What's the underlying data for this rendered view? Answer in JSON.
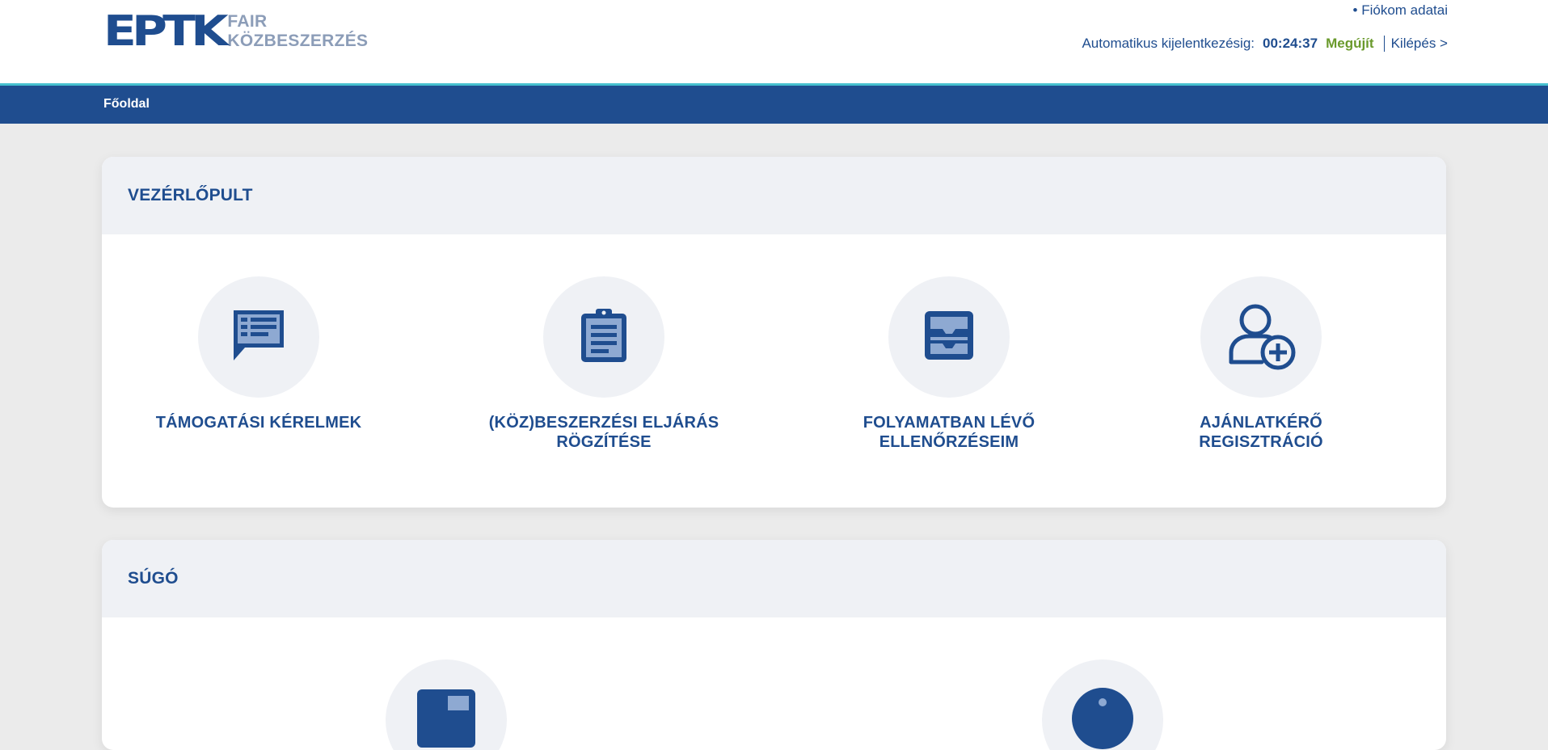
{
  "brand": {
    "logo_mark": "EPTK",
    "logo_line1": "FAIR",
    "logo_line2": "KÖZBESZERZÉS"
  },
  "header": {
    "account_link": "• Fiókom adatai",
    "session_label": "Automatikus kijelentkezésig:",
    "session_timer": "00:24:37",
    "renew_label": "Megújít",
    "logout_label": "Kilépés >"
  },
  "nav": {
    "home_label": "Főoldal"
  },
  "dashboard": {
    "title": "VEZÉRLŐPULT",
    "tiles": [
      {
        "label_line1": "TÁMOGATÁSI KÉRELMEK",
        "label_line2": "",
        "icon": "chat-list-icon"
      },
      {
        "label_line1": "(KÖZ)BESZERZÉSI ELJÁRÁS",
        "label_line2": "RÖGZÍTÉSE",
        "icon": "clipboard-icon"
      },
      {
        "label_line1": "FOLYAMATBAN LÉVŐ",
        "label_line2": "ELLENŐRZÉSEIM",
        "icon": "inbox-tray-icon"
      },
      {
        "label_line1": "AJÁNLATKÉRŐ",
        "label_line2": "REGISZTRÁCIÓ",
        "icon": "user-add-icon"
      }
    ]
  },
  "help": {
    "title": "SÚGÓ"
  },
  "colors": {
    "primary": "#1f4d8f",
    "accent_line": "#47c0cf",
    "renew": "#6a9a2c",
    "panel_head": "#eff1f5",
    "background": "#ebebeb"
  }
}
